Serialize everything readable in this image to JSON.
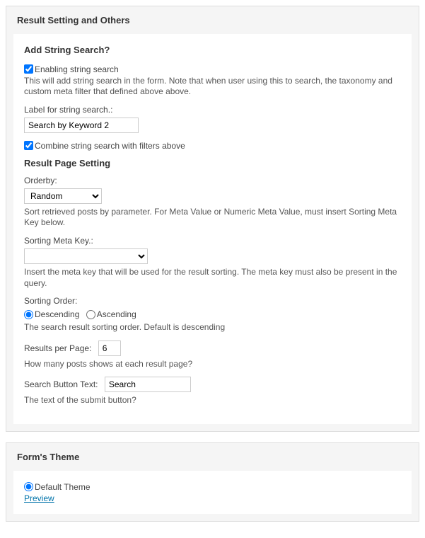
{
  "panel1": {
    "title": "Result Setting and Others"
  },
  "stringSearch": {
    "heading": "Add String Search?",
    "enableLabel": "Enabling string search",
    "enableHelp": "This will add string search in the form. Note that when user using this to search, the taxonomy and custom meta filter that defined above above.",
    "labelFieldLabel": "Label for string search.:",
    "labelFieldValue": "Search by Keyword 2",
    "combineLabel": "Combine string search with filters above"
  },
  "resultPage": {
    "heading": "Result Page Setting",
    "orderbyLabel": "Orderby:",
    "orderbyValue": "Random",
    "orderbyHelp": "Sort retrieved posts by parameter. For Meta Value or Numeric Meta Value, must insert Sorting Meta Key below.",
    "sortingMetaLabel": "Sorting Meta Key.:",
    "sortingMetaHelp": "Insert the meta key that will be used for the result sorting. The meta key must also be present in the query.",
    "sortingOrderLabel": "Sorting Order:",
    "descending": "Descending",
    "ascending": "Ascending",
    "sortingOrderHelp": "The search result sorting order. Default is descending",
    "resultsPerPageLabel": "Results per Page:",
    "resultsPerPageValue": "6",
    "resultsPerPageHelp": "How many posts shows at each result page?",
    "searchButtonLabel": "Search Button Text:",
    "searchButtonValue": "Search",
    "searchButtonHelp": "The text of the submit button?"
  },
  "theme": {
    "heading": "Form's Theme",
    "defaultLabel": "Default Theme",
    "previewLabel": "Preview"
  }
}
